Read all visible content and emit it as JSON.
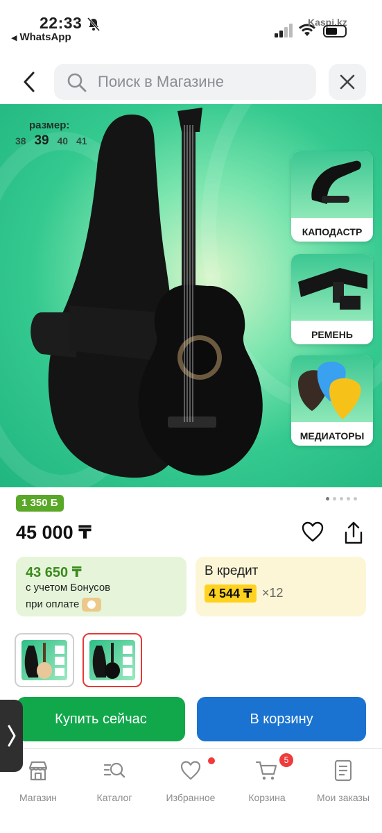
{
  "status_bar": {
    "time": "22:33",
    "back_app": "WhatsApp",
    "overlay_text": "Kaspi.kz"
  },
  "search": {
    "placeholder": "Поиск в Магазине"
  },
  "hero": {
    "size_label": "размер:",
    "sizes": [
      "38",
      "39",
      "40",
      "41"
    ],
    "selected_size": "39",
    "accessories": [
      {
        "label": "КАПОДАСТР",
        "icon": "capo-icon"
      },
      {
        "label": "РЕМЕНЬ",
        "icon": "strap-icon"
      },
      {
        "label": "МЕДИАТОРЫ",
        "icon": "picks-icon"
      }
    ],
    "carousel_dots": 5,
    "carousel_active": 0
  },
  "product": {
    "bonus_badge": "1 350 Б",
    "price": "45 000 ₸"
  },
  "payment": {
    "bonus_amount": "43 650 ₸",
    "bonus_line1": "с учетом Бонусов",
    "bonus_line2": "при оплате",
    "credit_title": "В кредит",
    "credit_amount": "4 544 ₸",
    "credit_times": "×12"
  },
  "actions": {
    "buy_now": "Купить сейчас",
    "add_to_cart": "В корзину"
  },
  "nav": {
    "items": [
      {
        "label": "Магазин",
        "icon": "store-icon"
      },
      {
        "label": "Каталог",
        "icon": "catalog-search-icon"
      },
      {
        "label": "Избранное",
        "icon": "heart-icon"
      },
      {
        "label": "Корзина",
        "icon": "cart-icon",
        "badge": "5"
      },
      {
        "label": "Мои заказы",
        "icon": "orders-icon"
      }
    ]
  },
  "colors": {
    "buy_green": "#11a84b",
    "cart_blue": "#1a73d1",
    "bonus_green": "#5aa827",
    "credit_yellow": "#ffd21f"
  }
}
